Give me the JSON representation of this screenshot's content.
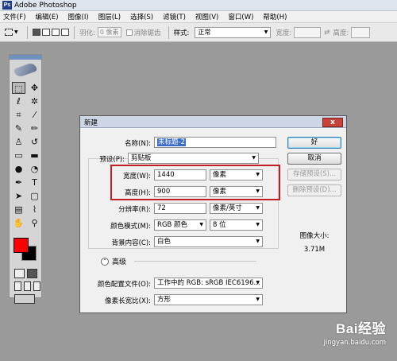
{
  "app": {
    "title": "Adobe Photoshop"
  },
  "menu": [
    "文件(F)",
    "编辑(E)",
    "图像(I)",
    "图层(L)",
    "选择(S)",
    "滤镜(T)",
    "视图(V)",
    "窗口(W)",
    "帮助(H)"
  ],
  "options": {
    "feather_label": "羽化:",
    "feather_value": "0 像素",
    "antialias_label": "消除锯齿",
    "style_label": "样式:",
    "style_value": "正常",
    "width_label": "宽度:",
    "height_label": "高度:"
  },
  "dialog": {
    "title": "新建",
    "name_label": "名称(N):",
    "name_value": "未标题-2",
    "preset_label": "预设(P):",
    "preset_value": "剪贴板",
    "width_label": "宽度(W):",
    "width_value": "1440",
    "width_unit": "像素",
    "height_label": "高度(H):",
    "height_value": "900",
    "height_unit": "像素",
    "resolution_label": "分辨率(R):",
    "resolution_value": "72",
    "resolution_unit": "像素/英寸",
    "color_mode_label": "颜色模式(M):",
    "color_mode_value": "RGB 颜色",
    "bit_depth_value": "8 位",
    "bg_label": "背景内容(C):",
    "bg_value": "白色",
    "advanced_label": "高级",
    "color_profile_label": "颜色配置文件(O):",
    "color_profile_value": "工作中的 RGB: sRGB IEC6196...",
    "pixel_aspect_label": "像素长宽比(X):",
    "pixel_aspect_value": "方形",
    "ok_button": "好",
    "cancel_button": "取消",
    "save_preset_button": "存储预设(S)...",
    "delete_preset_button": "删除预设(D)...",
    "image_size_label": "图像大小:",
    "image_size_value": "3.71M",
    "close_glyph": "x"
  },
  "watermark": {
    "logo": "Bai经验",
    "url": "jingyan.baidu.com"
  },
  "colors": {
    "foreground": "#ff0000",
    "background": "#000000",
    "highlight": "#c31d24"
  }
}
